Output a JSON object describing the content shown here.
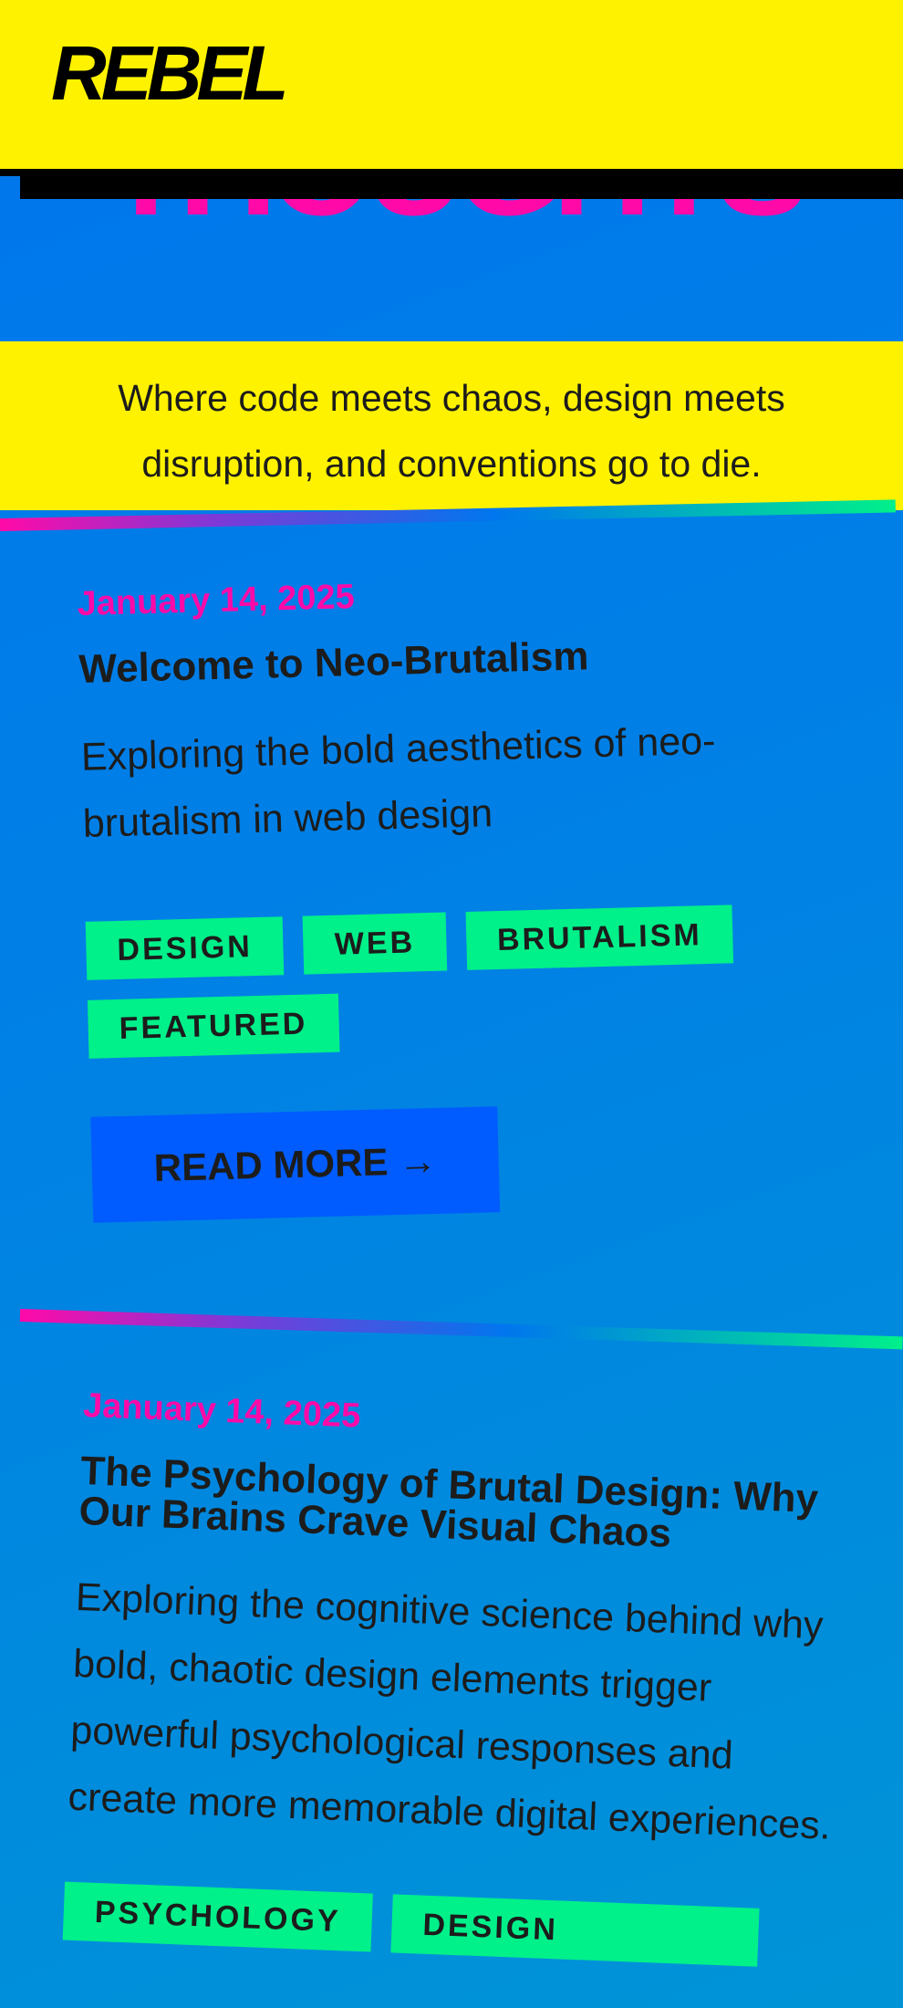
{
  "header": {
    "logo": "REBEL"
  },
  "hero": {
    "title": "THOUGHTS",
    "tagline": "Where code meets chaos, design meets disruption, and conventions go to die."
  },
  "posts": [
    {
      "date": "January 14, 2025",
      "title": "Welcome to Neo-Brutalism",
      "excerpt": "Exploring the bold aesthetics of neo-brutalism in web design",
      "tags": [
        "DESIGN",
        "WEB",
        "BRUTALISM",
        "FEATURED"
      ],
      "read_more": "READ MORE →"
    },
    {
      "date": "January 14, 2025",
      "title": "The Psychology of Brutal Design: Why Our Brains Crave Visual Chaos",
      "excerpt": "Exploring the cognitive science behind why bold, chaotic design elements trigger powerful psychological responses and create more memorable digital experiences.",
      "tags": [
        "PSYCHOLOGY",
        "DESIGN"
      ]
    }
  ],
  "colors": {
    "yellow": "#fff200",
    "pink": "#ff0aa8",
    "blue": "#0076ee",
    "green": "#00f08a",
    "button_blue": "#005cff"
  }
}
